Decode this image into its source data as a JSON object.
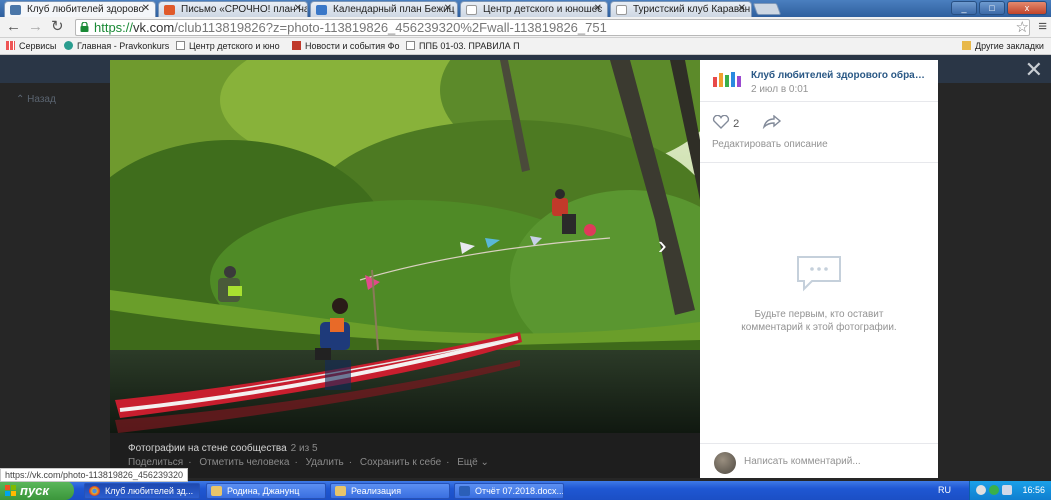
{
  "browser": {
    "tabs": [
      {
        "label": "Клуб любителей здорово",
        "favicon_color": "#4a76a8",
        "active": true
      },
      {
        "label": "Письмо «СРОЧНО! план на",
        "favicon_color": "#e05a2a",
        "active": false
      },
      {
        "label": "Календарный план Бежиц",
        "favicon_color": "#3a78c8",
        "active": false
      },
      {
        "label": "Центр детского и юношес",
        "favicon_color": "#ffffff",
        "active": false
      },
      {
        "label": "Туристский клуб Караван",
        "favicon_color": "#ffffff",
        "active": false
      }
    ],
    "window_buttons": {
      "minimize": "_",
      "maximize": "□",
      "close": "x"
    },
    "url_scheme": "https://",
    "url_host": "vk.com",
    "url_rest": "/club113819826?z=photo-113819826_456239320%2Fwall-113819826_751",
    "bookmarks": [
      {
        "label": "Сервисы",
        "icon": "apps-icon"
      },
      {
        "label": "Главная - Pravkonkurs",
        "icon": "pravkonkurs-icon"
      },
      {
        "label": "Центр детского и юно",
        "icon": "page-icon"
      },
      {
        "label": "Новости и события Фо",
        "icon": "news-icon"
      },
      {
        "label": "ППБ 01-03. ПРАВИЛА П",
        "icon": "page-icon"
      }
    ],
    "other_bookmarks": "Другие закладки"
  },
  "viewer": {
    "back_label": "Назад",
    "caption_title": "Фотографии на стене сообщества",
    "caption_count": "2 из 5",
    "actions": [
      "Поделиться",
      "Отметить человека",
      "Удалить",
      "Сохранить к себе",
      "Ещё ⌄"
    ]
  },
  "panel": {
    "group_name": "Клуб любителей здорового образа ...",
    "date": "2 июл в 0:01",
    "likes": "2",
    "edit_description": "Редактировать описание",
    "empty_line1": "Будьте первым, кто оставит",
    "empty_line2": "комментарий к этой фотографии.",
    "comment_placeholder": "Написать комментарий..."
  },
  "status_url": "https://vk.com/photo-113819826_456239320",
  "taskbar": {
    "start": "пуск",
    "tasks": [
      {
        "label": "Клуб любителей зд...",
        "icon_color": "#e8b82a"
      },
      {
        "label": "Родина, Джанунц",
        "icon_color": "#e8c56a"
      },
      {
        "label": "Реализация",
        "icon_color": "#e8c56a"
      },
      {
        "label": "Отчёт 07.2018.docx...",
        "icon_color": "#2b5fb8"
      }
    ],
    "language": "RU",
    "clock": "16:56"
  }
}
